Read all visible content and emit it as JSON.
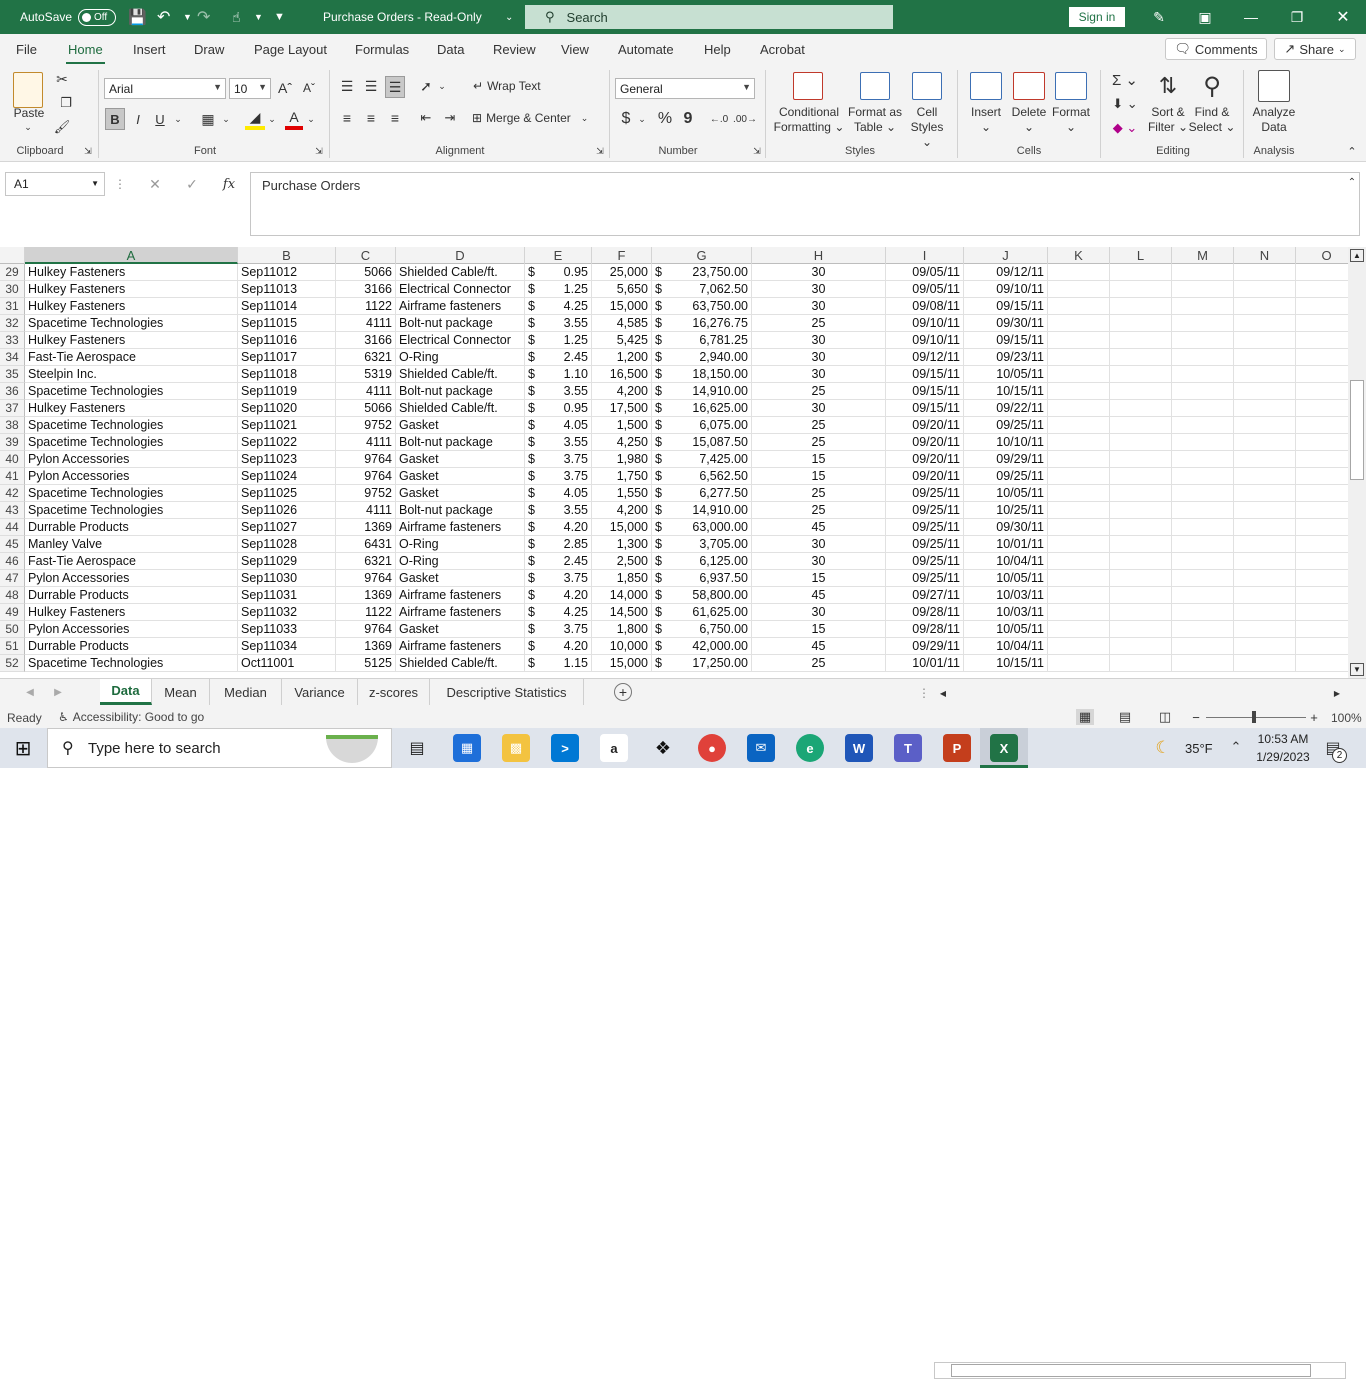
{
  "titlebar": {
    "autosave_label": "AutoSave",
    "autosave_state": "Off",
    "doc_title": "Purchase Orders  -  Read-Only",
    "search_placeholder": "Search",
    "signin_label": "Sign in"
  },
  "menu": {
    "tabs": [
      "File",
      "Home",
      "Insert",
      "Draw",
      "Page Layout",
      "Formulas",
      "Data",
      "Review",
      "View",
      "Automate",
      "Help",
      "Acrobat"
    ],
    "active": "Home",
    "comments_label": "Comments",
    "share_label": "Share"
  },
  "ribbon": {
    "clipboard": {
      "group": "Clipboard",
      "paste": "Paste"
    },
    "font": {
      "group": "Font",
      "family": "Arial",
      "size": "10",
      "bold": "B",
      "italic": "I",
      "underline": "U"
    },
    "alignment": {
      "group": "Alignment",
      "wrap": "Wrap Text",
      "merge": "Merge & Center"
    },
    "number": {
      "group": "Number",
      "format": "General",
      "currency": "$",
      "percent": "%",
      "comma": "9"
    },
    "styles": {
      "group": "Styles",
      "cond1": "Conditional",
      "cond2": "Formatting",
      "fmt1": "Format as",
      "fmt2": "Table",
      "cell1": "Cell",
      "cell2": "Styles"
    },
    "cells": {
      "group": "Cells",
      "insert": "Insert",
      "delete": "Delete",
      "format": "Format"
    },
    "editing": {
      "group": "Editing",
      "sort1": "Sort &",
      "sort2": "Filter",
      "find1": "Find &",
      "find2": "Select"
    },
    "analysis": {
      "group": "Analysis",
      "analyze1": "Analyze",
      "analyze2": "Data"
    }
  },
  "formula_bar": {
    "name_box": "A1",
    "fx": "fx",
    "content": "Purchase Orders"
  },
  "columns": [
    "A",
    "B",
    "C",
    "D",
    "E",
    "F",
    "G",
    "H",
    "I",
    "J",
    "K",
    "L",
    "M",
    "N",
    "O"
  ],
  "rows": [
    {
      "n": "29",
      "a": "Hulkey Fasteners",
      "b": "Sep11012",
      "c": "5066",
      "d": "Shielded Cable/ft.",
      "e": "0.95",
      "f": "25,000",
      "g": "23,750.00",
      "h": "30",
      "i": "09/05/11",
      "j": "09/12/11"
    },
    {
      "n": "30",
      "a": "Hulkey Fasteners",
      "b": "Sep11013",
      "c": "3166",
      "d": "Electrical Connector",
      "e": "1.25",
      "f": "5,650",
      "g": "7,062.50",
      "h": "30",
      "i": "09/05/11",
      "j": "09/10/11"
    },
    {
      "n": "31",
      "a": "Hulkey Fasteners",
      "b": "Sep11014",
      "c": "1122",
      "d": "Airframe fasteners",
      "e": "4.25",
      "f": "15,000",
      "g": "63,750.00",
      "h": "30",
      "i": "09/08/11",
      "j": "09/15/11"
    },
    {
      "n": "32",
      "a": "Spacetime Technologies",
      "b": "Sep11015",
      "c": "4111",
      "d": "Bolt-nut package",
      "e": "3.55",
      "f": "4,585",
      "g": "16,276.75",
      "h": "25",
      "i": "09/10/11",
      "j": "09/30/11"
    },
    {
      "n": "33",
      "a": "Hulkey Fasteners",
      "b": "Sep11016",
      "c": "3166",
      "d": "Electrical Connector",
      "e": "1.25",
      "f": "5,425",
      "g": "6,781.25",
      "h": "30",
      "i": "09/10/11",
      "j": "09/15/11"
    },
    {
      "n": "34",
      "a": "Fast-Tie Aerospace",
      "b": "Sep11017",
      "c": "6321",
      "d": "O-Ring",
      "e": "2.45",
      "f": "1,200",
      "g": "2,940.00",
      "h": "30",
      "i": "09/12/11",
      "j": "09/23/11"
    },
    {
      "n": "35",
      "a": "Steelpin Inc.",
      "b": "Sep11018",
      "c": "5319",
      "d": "Shielded Cable/ft.",
      "e": "1.10",
      "f": "16,500",
      "g": "18,150.00",
      "h": "30",
      "i": "09/15/11",
      "j": "10/05/11"
    },
    {
      "n": "36",
      "a": "Spacetime Technologies",
      "b": "Sep11019",
      "c": "4111",
      "d": "Bolt-nut package",
      "e": "3.55",
      "f": "4,200",
      "g": "14,910.00",
      "h": "25",
      "i": "09/15/11",
      "j": "10/15/11"
    },
    {
      "n": "37",
      "a": "Hulkey Fasteners",
      "b": "Sep11020",
      "c": "5066",
      "d": "Shielded Cable/ft.",
      "e": "0.95",
      "f": "17,500",
      "g": "16,625.00",
      "h": "30",
      "i": "09/15/11",
      "j": "09/22/11"
    },
    {
      "n": "38",
      "a": "Spacetime Technologies",
      "b": "Sep11021",
      "c": "9752",
      "d": "Gasket",
      "e": "4.05",
      "f": "1,500",
      "g": "6,075.00",
      "h": "25",
      "i": "09/20/11",
      "j": "09/25/11"
    },
    {
      "n": "39",
      "a": "Spacetime Technologies",
      "b": "Sep11022",
      "c": "4111",
      "d": "Bolt-nut package",
      "e": "3.55",
      "f": "4,250",
      "g": "15,087.50",
      "h": "25",
      "i": "09/20/11",
      "j": "10/10/11"
    },
    {
      "n": "40",
      "a": "Pylon Accessories",
      "b": "Sep11023",
      "c": "9764",
      "d": "Gasket",
      "e": "3.75",
      "f": "1,980",
      "g": "7,425.00",
      "h": "15",
      "i": "09/20/11",
      "j": "09/29/11"
    },
    {
      "n": "41",
      "a": "Pylon Accessories",
      "b": "Sep11024",
      "c": "9764",
      "d": "Gasket",
      "e": "3.75",
      "f": "1,750",
      "g": "6,562.50",
      "h": "15",
      "i": "09/20/11",
      "j": "09/25/11"
    },
    {
      "n": "42",
      "a": "Spacetime Technologies",
      "b": "Sep11025",
      "c": "9752",
      "d": "Gasket",
      "e": "4.05",
      "f": "1,550",
      "g": "6,277.50",
      "h": "25",
      "i": "09/25/11",
      "j": "10/05/11"
    },
    {
      "n": "43",
      "a": "Spacetime Technologies",
      "b": "Sep11026",
      "c": "4111",
      "d": "Bolt-nut package",
      "e": "3.55",
      "f": "4,200",
      "g": "14,910.00",
      "h": "25",
      "i": "09/25/11",
      "j": "10/25/11"
    },
    {
      "n": "44",
      "a": "Durrable Products",
      "b": "Sep11027",
      "c": "1369",
      "d": "Airframe fasteners",
      "e": "4.20",
      "f": "15,000",
      "g": "63,000.00",
      "h": "45",
      "i": "09/25/11",
      "j": "09/30/11"
    },
    {
      "n": "45",
      "a": "Manley Valve",
      "b": "Sep11028",
      "c": "6431",
      "d": "O-Ring",
      "e": "2.85",
      "f": "1,300",
      "g": "3,705.00",
      "h": "30",
      "i": "09/25/11",
      "j": "10/01/11"
    },
    {
      "n": "46",
      "a": "Fast-Tie Aerospace",
      "b": "Sep11029",
      "c": "6321",
      "d": "O-Ring",
      "e": "2.45",
      "f": "2,500",
      "g": "6,125.00",
      "h": "30",
      "i": "09/25/11",
      "j": "10/04/11"
    },
    {
      "n": "47",
      "a": "Pylon Accessories",
      "b": "Sep11030",
      "c": "9764",
      "d": "Gasket",
      "e": "3.75",
      "f": "1,850",
      "g": "6,937.50",
      "h": "15",
      "i": "09/25/11",
      "j": "10/05/11"
    },
    {
      "n": "48",
      "a": "Durrable Products",
      "b": "Sep11031",
      "c": "1369",
      "d": "Airframe fasteners",
      "e": "4.20",
      "f": "14,000",
      "g": "58,800.00",
      "h": "45",
      "i": "09/27/11",
      "j": "10/03/11"
    },
    {
      "n": "49",
      "a": "Hulkey Fasteners",
      "b": "Sep11032",
      "c": "1122",
      "d": "Airframe fasteners",
      "e": "4.25",
      "f": "14,500",
      "g": "61,625.00",
      "h": "30",
      "i": "09/28/11",
      "j": "10/03/11"
    },
    {
      "n": "50",
      "a": "Pylon Accessories",
      "b": "Sep11033",
      "c": "9764",
      "d": "Gasket",
      "e": "3.75",
      "f": "1,800",
      "g": "6,750.00",
      "h": "15",
      "i": "09/28/11",
      "j": "10/05/11"
    },
    {
      "n": "51",
      "a": "Durrable Products",
      "b": "Sep11034",
      "c": "1369",
      "d": "Airframe fasteners",
      "e": "4.20",
      "f": "10,000",
      "g": "42,000.00",
      "h": "45",
      "i": "09/29/11",
      "j": "10/04/11"
    },
    {
      "n": "52",
      "a": "Spacetime Technologies",
      "b": "Oct11001",
      "c": "5125",
      "d": "Shielded Cable/ft.",
      "e": "1.15",
      "f": "15,000",
      "g": "17,250.00",
      "h": "25",
      "i": "10/01/11",
      "j": "10/15/11"
    }
  ],
  "currency_symbol": "$",
  "sheets": [
    "Data",
    "Mean",
    "Median",
    "Variance",
    "z-scores",
    "Descriptive Statistics"
  ],
  "active_sheet": "Data",
  "status": {
    "ready": "Ready",
    "accessibility": "Accessibility: Good to go",
    "zoom": "100%"
  },
  "taskbar": {
    "search_placeholder": "Type here to search",
    "weather": "35°F",
    "time": "10:53 AM",
    "date": "1/29/2023",
    "notifications": "2"
  },
  "colors": {
    "excel_green": "#217346",
    "ribbon_bg": "#f3f3f3"
  }
}
